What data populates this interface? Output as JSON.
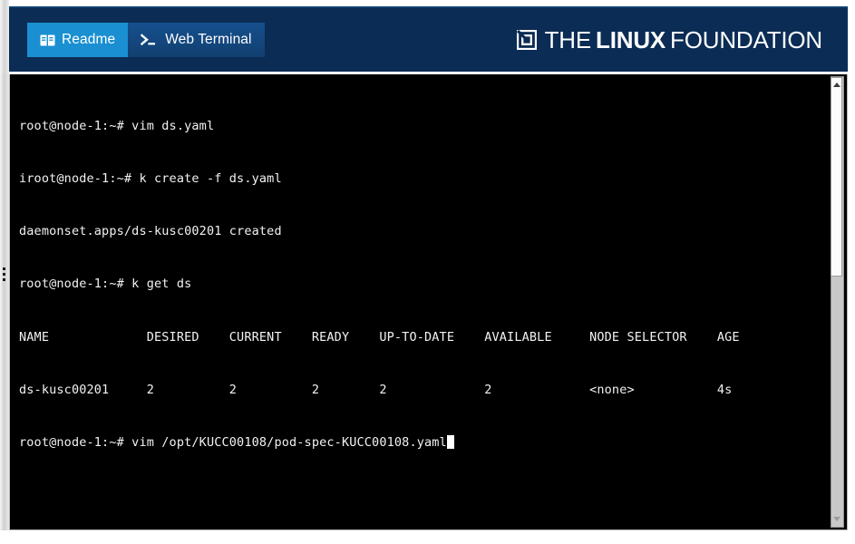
{
  "header": {
    "background_color": "#0b2c54",
    "tabs": [
      {
        "id": "readme",
        "label": "Readme",
        "icon": "book-icon",
        "active": true,
        "color": "#1a8fd1"
      },
      {
        "id": "web-terminal",
        "label": "Web Terminal",
        "icon": "command-prompt-icon",
        "active": false,
        "color": "#134a84"
      }
    ],
    "brand": {
      "mark": "linux-foundation-mark-icon",
      "the": "THE",
      "linux": "LINUX",
      "foundation": "FOUNDATION"
    }
  },
  "terminal": {
    "background_color": "#000000",
    "text_color": "#f2f2f2",
    "lines": [
      "root@node-1:~# vim ds.yaml",
      "iroot@node-1:~# k create -f ds.yaml",
      "daemonset.apps/ds-kusc00201 created",
      "root@node-1:~# k get ds",
      "NAME             DESIRED    CURRENT    READY    UP-TO-DATE    AVAILABLE     NODE SELECTOR    AGE",
      "ds-kusc00201     2          2          2        2             2             <none>           4s"
    ],
    "prompt_line": "root@node-1:~# vim /opt/KUCC00108/pod-spec-KUCC00108.yaml",
    "cursor": "block",
    "table": {
      "columns": [
        "NAME",
        "DESIRED",
        "CURRENT",
        "READY",
        "UP-TO-DATE",
        "AVAILABLE",
        "NODE SELECTOR",
        "AGE"
      ],
      "rows": [
        [
          "ds-kusc00201",
          "2",
          "2",
          "2",
          "2",
          "2",
          "<none>",
          "4s"
        ]
      ]
    }
  },
  "scrollbar": {
    "up_arrow": "triangle-up-icon",
    "down_arrow": "triangle-down-icon",
    "thumb_position": "top"
  },
  "splitter": {
    "handle": "drag-handle-dots-icon"
  }
}
